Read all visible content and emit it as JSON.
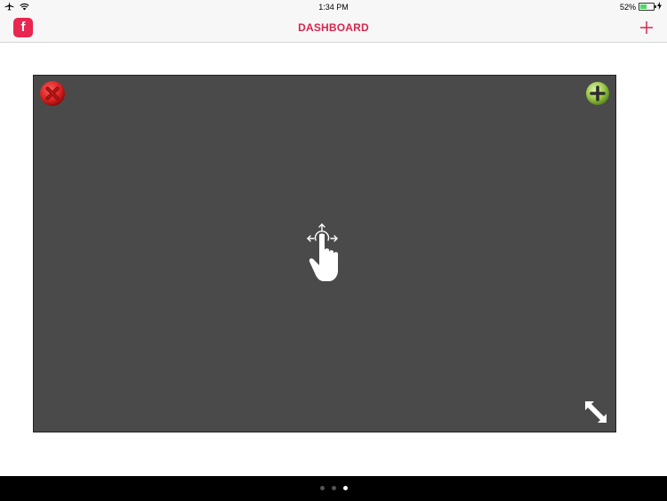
{
  "status_bar": {
    "time": "1:34 PM",
    "battery_percent": "52%",
    "battery_level": 0.52,
    "icons": [
      "airplane-icon",
      "wifi-icon",
      "battery-icon",
      "charging-icon"
    ]
  },
  "nav": {
    "title": "DASHBOARD",
    "app_icon_letter": "f",
    "add_icon": "+"
  },
  "widget": {
    "remove_icon": "close-icon",
    "add_icon": "plus-icon",
    "hint_icon": "drag-gesture-icon",
    "resize_icon": "resize-icon"
  },
  "pager": {
    "count": 3,
    "active_index": 2
  },
  "colors": {
    "accent": "#d8264f",
    "widget_background": "#4a4a4a",
    "remove": "#d41f1f",
    "add": "#8fbf3f",
    "bottom_bar": "#000000"
  }
}
